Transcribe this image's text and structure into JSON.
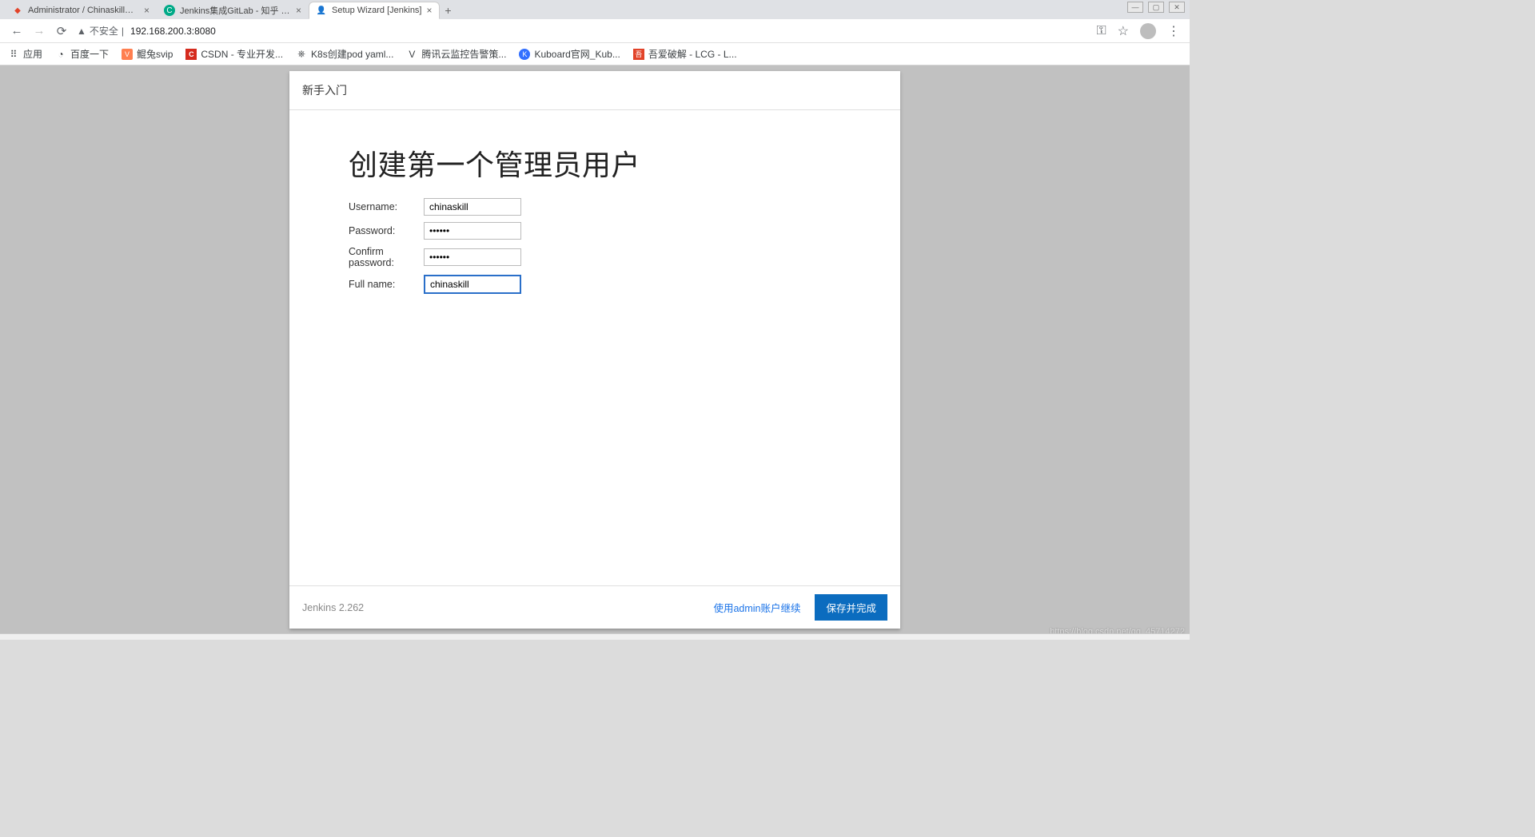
{
  "os_controls": {
    "min": "—",
    "max": "▢",
    "close": "✕"
  },
  "tabs": [
    {
      "title": "Administrator / ChinaskillProje...",
      "favicon": "gitlab"
    },
    {
      "title": "Jenkins集成GitLab - 知乎 - osc...",
      "favicon": "zhihu"
    },
    {
      "title": "Setup Wizard [Jenkins]",
      "favicon": "jenkins",
      "active": true
    }
  ],
  "newtab": "+",
  "addrbar": {
    "secure_warn": "▲",
    "secure_text": "不安全",
    "url": "192.168.200.3:8080",
    "key_icon": "⚿",
    "star_icon": "☆",
    "avatar_icon": "●",
    "menu_icon": "⋮"
  },
  "bookmarks": [
    {
      "icon": "⠿",
      "label": "应用",
      "cls": ""
    },
    {
      "icon": "◔",
      "label": "百度一下",
      "cls": ""
    },
    {
      "icon": "V",
      "label": "鲲兔svip",
      "cls": "sq-orange"
    },
    {
      "icon": "C",
      "label": "CSDN - 专业开发...",
      "cls": "sq-red"
    },
    {
      "icon": "⎈",
      "label": "K8s创建pod yaml...",
      "cls": ""
    },
    {
      "icon": "V",
      "label": "腾讯云监控告警策...",
      "cls": ""
    },
    {
      "icon": "K",
      "label": "Kuboard官网_Kub...",
      "cls": "sq-blue"
    },
    {
      "icon": "吾",
      "label": "吾爱破解 - LCG - L...",
      "cls": "sq-red2"
    }
  ],
  "card": {
    "head": "新手入门",
    "title": "创建第一个管理员用户",
    "fields": {
      "username_label": "Username:",
      "username_value": "chinaskill",
      "password_label": "Password:",
      "password_value": "••••••",
      "confirm_label": "Confirm password:",
      "confirm_value": "••••••",
      "fullname_label": "Full name:",
      "fullname_value": "chinaskill"
    },
    "footer": {
      "version": "Jenkins 2.262",
      "skip_link": "使用admin账户继续",
      "save_button": "保存并完成"
    }
  },
  "watermark": "https://blog.csdn.net/qq_45714272"
}
